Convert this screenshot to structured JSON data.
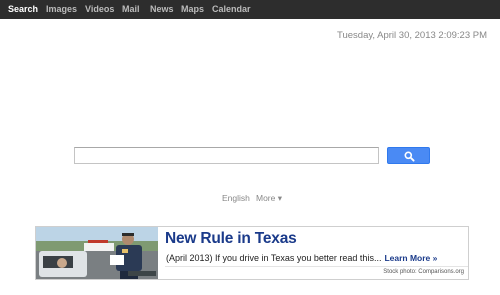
{
  "nav": {
    "items": [
      {
        "label": "Search",
        "active": true
      },
      {
        "label": "Images",
        "active": false
      },
      {
        "label": "Videos",
        "active": false
      },
      {
        "label": "Mail",
        "active": false
      },
      {
        "label": "News",
        "active": false
      },
      {
        "label": "Maps",
        "active": false
      },
      {
        "label": "Calendar",
        "active": false
      }
    ]
  },
  "datetime": "Tuesday, April 30, 2013 2:09:23 PM",
  "search": {
    "value": "",
    "placeholder": "",
    "button_icon": "search-icon"
  },
  "language": {
    "current": "English",
    "more": "More ▾"
  },
  "ad": {
    "title": "New Rule in Texas",
    "body": "(April 2013) If you drive in Texas you better read this...",
    "cta": "Learn More »",
    "credit": "Stock photo: Comparisons.org"
  },
  "colors": {
    "topbar": "#2d2d2d",
    "search_button": "#4a8af4",
    "ad_title": "#1a3a8a"
  }
}
